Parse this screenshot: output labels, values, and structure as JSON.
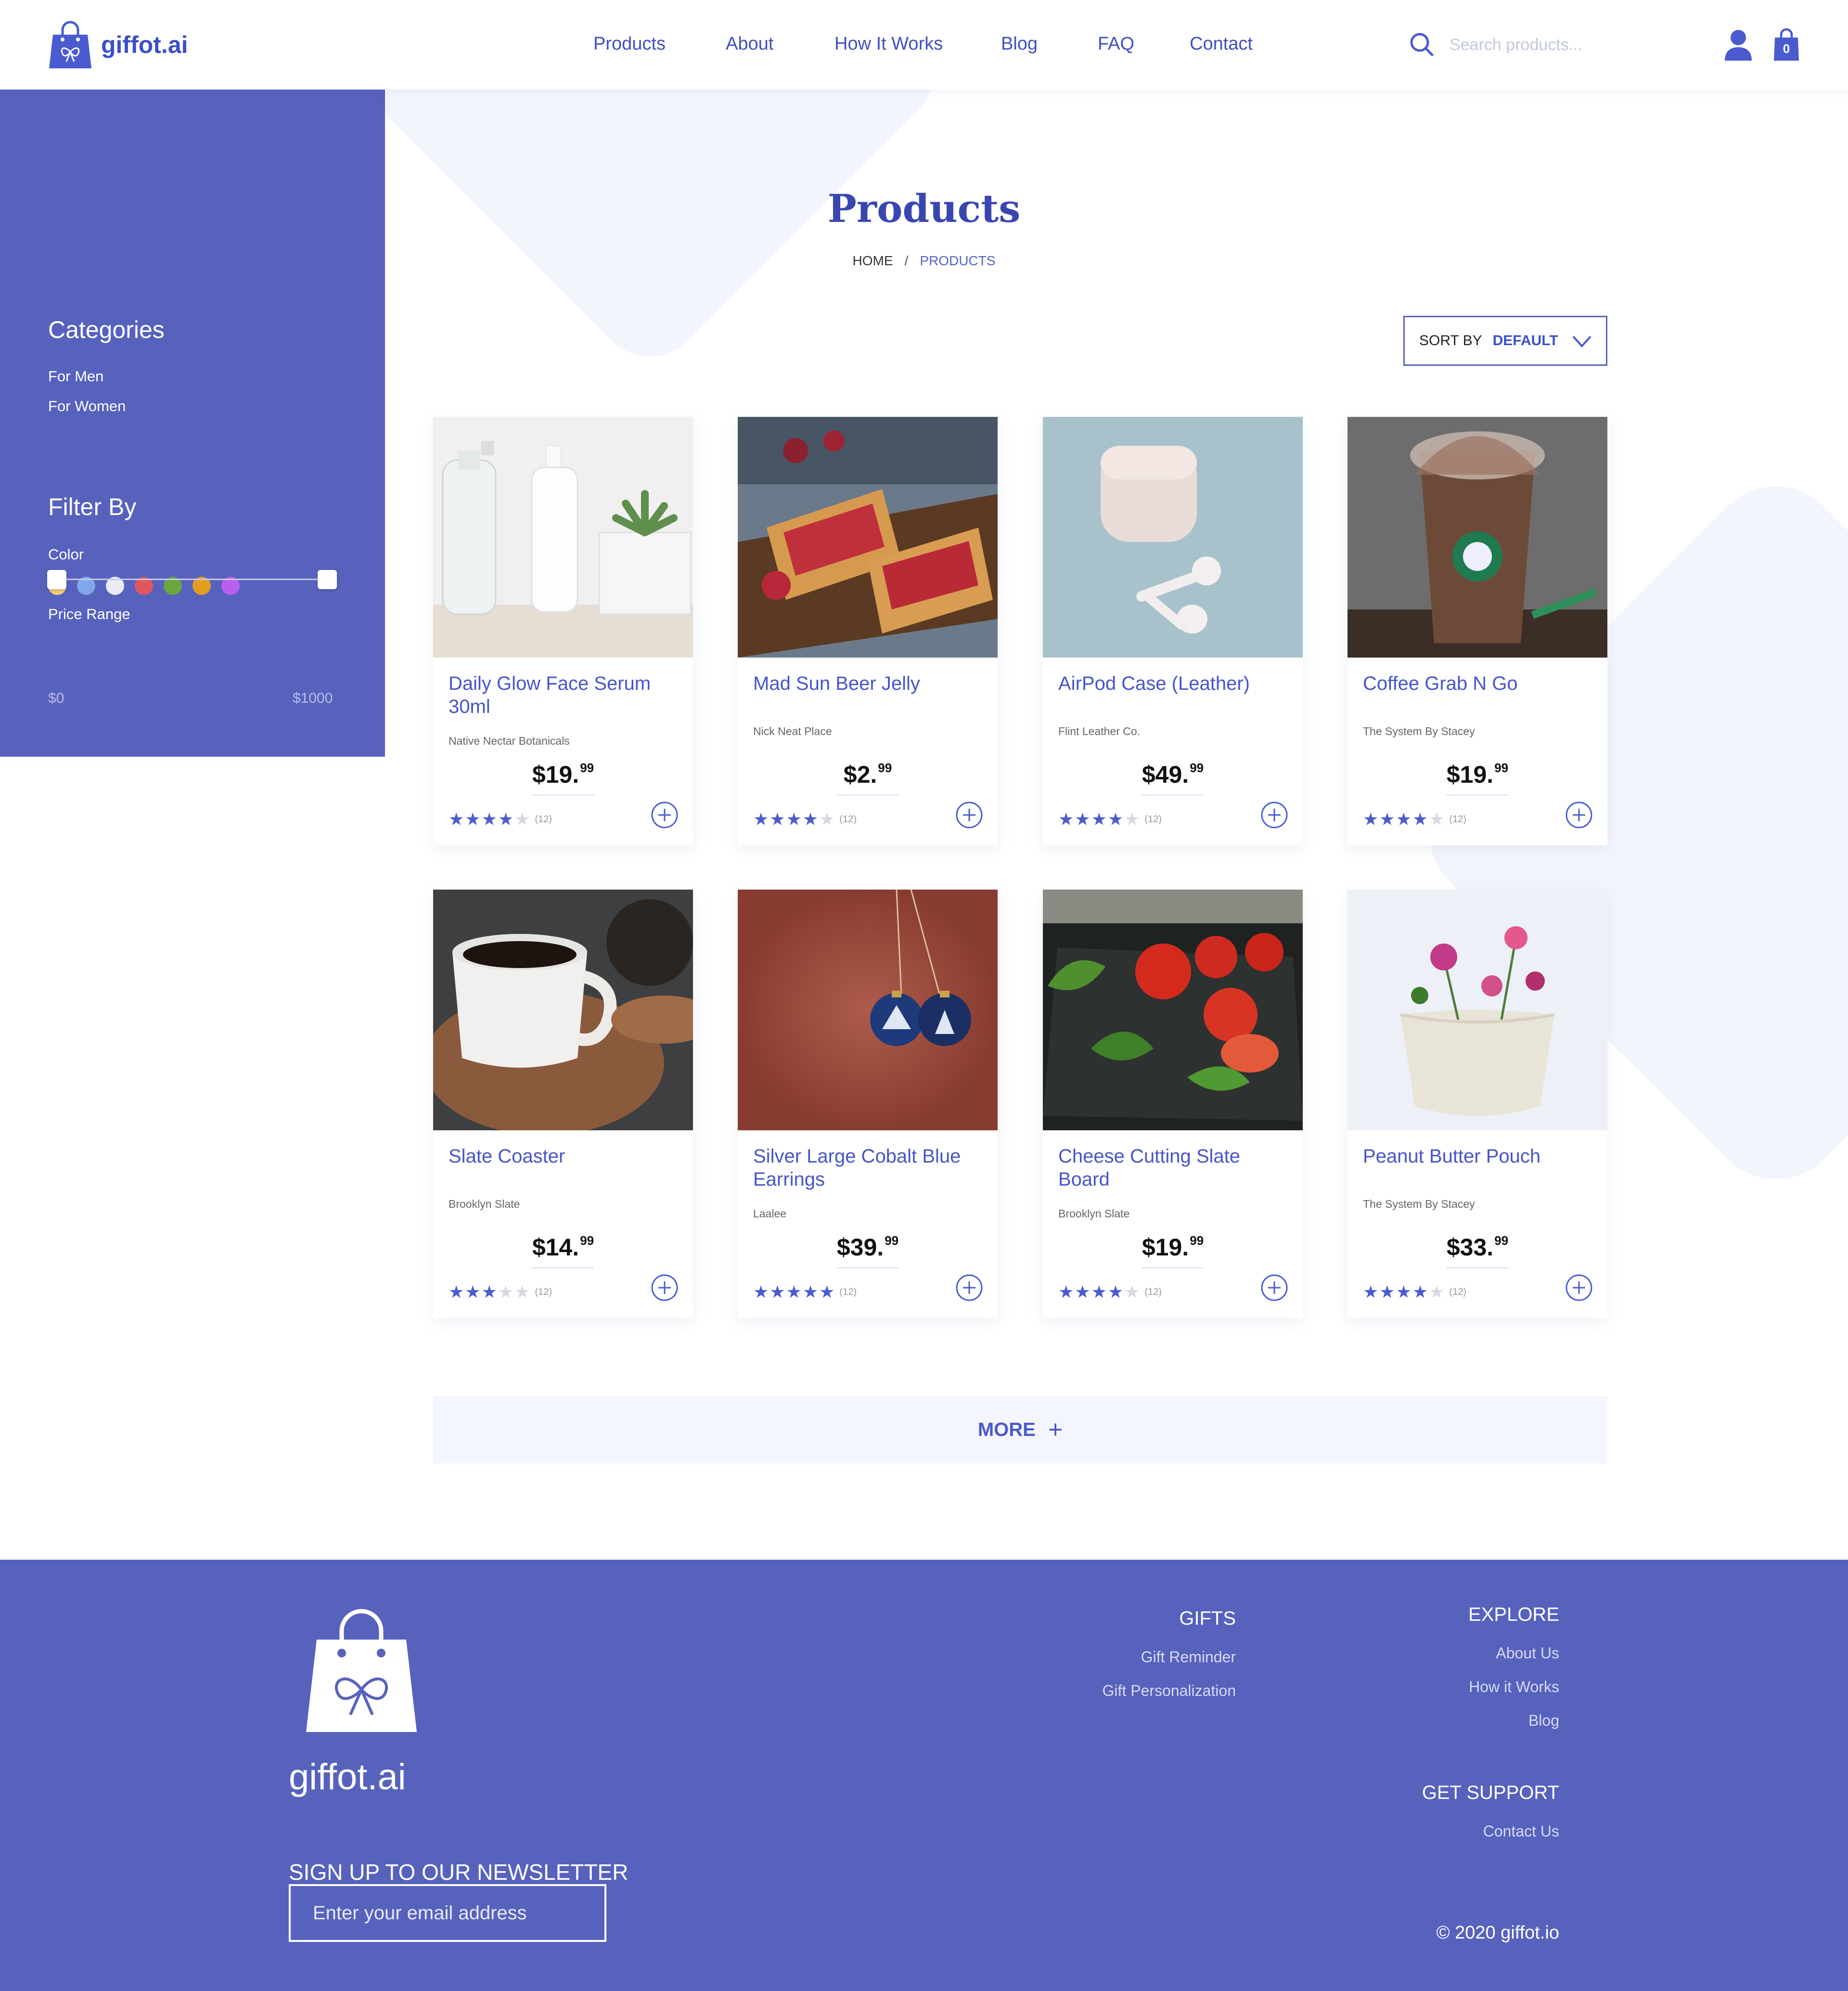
{
  "brand": {
    "name": "giffot.ai"
  },
  "nav": [
    {
      "label": "Products"
    },
    {
      "label": "About"
    },
    {
      "label": "How It Works"
    },
    {
      "label": "Blog"
    },
    {
      "label": "FAQ"
    },
    {
      "label": "Contact"
    }
  ],
  "search": {
    "placeholder": "Search products..."
  },
  "cart": {
    "count": "0"
  },
  "page": {
    "title": "Products"
  },
  "breadcrumb": {
    "home": "HOME",
    "separator": "/",
    "current": "PRODUCTS"
  },
  "sort": {
    "label": "SORT BY",
    "value": "DEFAULT"
  },
  "sidebar": {
    "categories_title": "Categories",
    "categories": [
      "For Men",
      "For Women"
    ],
    "filter_title": "Filter By",
    "color_label": "Color",
    "colors": [
      "#f5cd78",
      "#7fa8ea",
      "#e9ecf5",
      "#e0575e",
      "#6aa63e",
      "#e39e22",
      "#b85ef0"
    ],
    "price_label": "Price Range",
    "price_min": "$0",
    "price_max": "$1000"
  },
  "products": [
    {
      "name": "Daily Glow Face Serum 30ml",
      "brand": "Native Nectar Botanicals",
      "price_main": "$19",
      "price_cents": "99",
      "rating": 4,
      "reviews": "(12)",
      "image": "serum-bottles"
    },
    {
      "name": "Mad Sun Beer Jelly",
      "brand": "Nick Neat Place",
      "price_main": "$2",
      "price_cents": "99",
      "rating": 4,
      "reviews": "(12)",
      "image": "jelly-toast"
    },
    {
      "name": "AirPod Case (Leather)",
      "brand": "Flint Leather Co.",
      "price_main": "$49",
      "price_cents": "99",
      "rating": 4,
      "reviews": "(12)",
      "image": "airpods"
    },
    {
      "name": "Coffee Grab N Go",
      "brand": "The System By Stacey",
      "price_main": "$19",
      "price_cents": "99",
      "rating": 4,
      "reviews": "(12)",
      "image": "iced-coffee"
    },
    {
      "name": "Slate Coaster",
      "brand": "Brooklyn Slate",
      "price_main": "$14",
      "price_cents": "99",
      "rating": 3,
      "reviews": "(12)",
      "image": "coffee-coaster"
    },
    {
      "name": "Silver Large Cobalt Blue Earrings",
      "brand": "Laalee",
      "price_main": "$39",
      "price_cents": "99",
      "rating": 5,
      "reviews": "(12)",
      "image": "blue-ornaments"
    },
    {
      "name": "Cheese Cutting Slate Board",
      "brand": "Brooklyn Slate",
      "price_main": "$19",
      "price_cents": "99",
      "rating": 4,
      "reviews": "(12)",
      "image": "tomatoes-board"
    },
    {
      "name": "Peanut Butter Pouch",
      "brand": "The System By Stacey",
      "price_main": "$33",
      "price_cents": "99",
      "rating": 4,
      "reviews": "(12)",
      "image": "flower-pouch"
    }
  ],
  "more": {
    "label": "MORE"
  },
  "footer": {
    "brand": "giffot.ai",
    "newsletter_title": "SIGN UP TO OUR NEWSLETTER",
    "email_placeholder": "Enter your email address",
    "gifts_title": "GIFTS",
    "gifts_links": [
      "Gift Reminder",
      "Gift Personalization"
    ],
    "explore_title": "EXPLORE",
    "explore_links": [
      "About Us",
      "How it Works",
      "Blog"
    ],
    "support_title": "GET SUPPORT",
    "support_links": [
      "Contact Us"
    ],
    "copyright": "© 2020 giffot.io"
  },
  "colors": {
    "primary": "#5762bd",
    "accent": "#3b4fc7",
    "more_bg": "#f3f6fe"
  }
}
